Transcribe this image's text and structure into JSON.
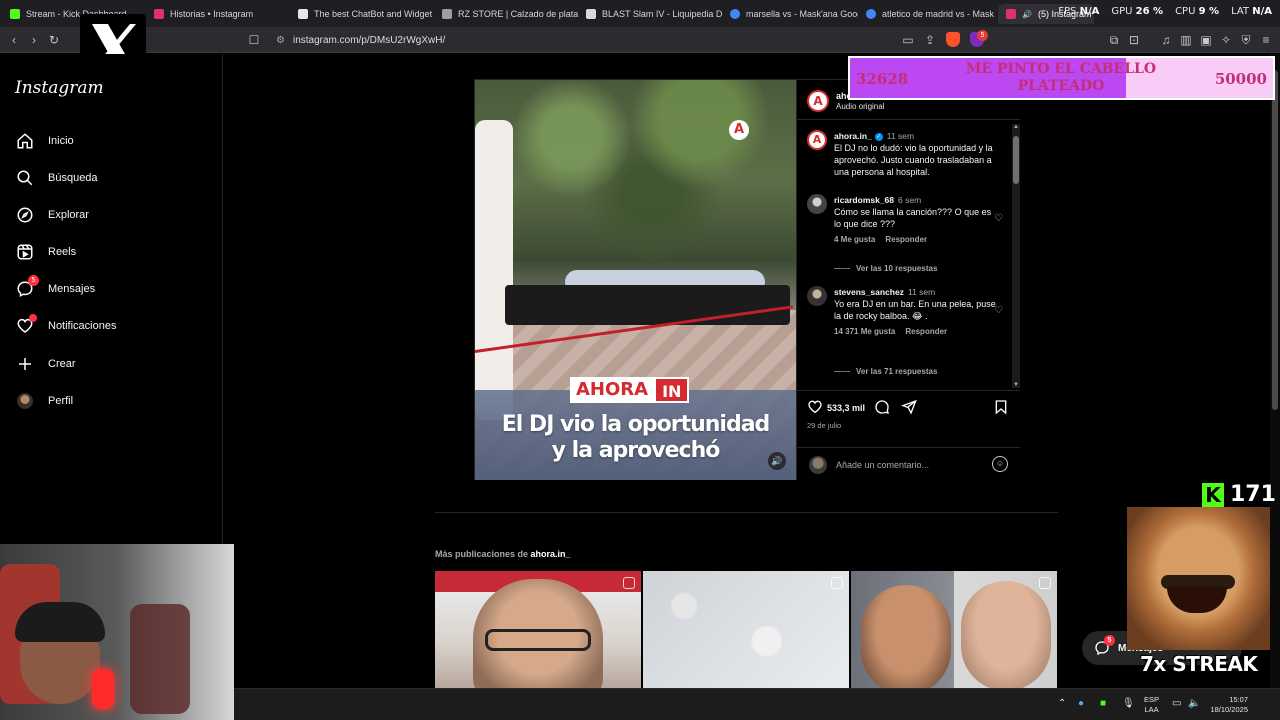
{
  "browser": {
    "tabs": [
      {
        "title": "Stream - Kick Dashboard",
        "fav_color": "#53fc18"
      },
      {
        "title": "Historias • Instagram",
        "fav_color": "#e1306c"
      },
      {
        "title": "The best ChatBot and Widget",
        "fav_color": "#e6e6e6"
      },
      {
        "title": "RZ STORE | Calzado de platafo",
        "fav_color": "#9e9e9e"
      },
      {
        "title": "BLAST Slam IV - Liquipedia Do",
        "fav_color": "#d9d9d9"
      },
      {
        "title": "marsella vs - Mask'ana Google",
        "fav_color": "#4285f4"
      },
      {
        "title": "atletico de madrid vs - Mask'a",
        "fav_color": "#4285f4"
      },
      {
        "title": "(5) Instagram",
        "fav_color": "#e1306c",
        "active": true
      }
    ],
    "url": "instagram.com/p/DMsU2rWgXwH/",
    "perf": {
      "fps_label": "FPS",
      "fps_value": "N/A",
      "gpu_label": "GPU",
      "gpu_value": "26 %",
      "cpu_label": "CPU",
      "cpu_value": "9 %",
      "lat_label": "LAT",
      "lat_value": "N/A"
    },
    "extension_badge": "5"
  },
  "sidebar": {
    "logo": "Instagram",
    "items": [
      {
        "label": "Inicio",
        "icon": "home-icon"
      },
      {
        "label": "Búsqueda",
        "icon": "search-icon"
      },
      {
        "label": "Explorar",
        "icon": "compass-icon"
      },
      {
        "label": "Reels",
        "icon": "reels-icon"
      },
      {
        "label": "Mensajes",
        "icon": "messenger-icon",
        "badge": "5"
      },
      {
        "label": "Notificaciones",
        "icon": "heart-icon",
        "dot": true
      },
      {
        "label": "Crear",
        "icon": "plus-icon"
      },
      {
        "label": "Perfil",
        "icon": "avatar-icon"
      }
    ]
  },
  "post": {
    "author": "ahora.in_",
    "audio": "Audio original",
    "media": {
      "brand_word": "AHORA",
      "brand_tag": "IN",
      "headline_line1": "El DJ vio la oportunidad",
      "headline_line2": "y la aprovechó",
      "logo_letter": "A"
    },
    "comments": [
      {
        "user": "ahora.in_",
        "verified": true,
        "time": "11 sem",
        "text": "El DJ no lo dudó: vio la oportunidad y la aprovechó. Justo cuando trasladaban a una persona al hospital."
      },
      {
        "user": "ricardomsk_68",
        "time": "6 sem",
        "text": "Cómo se llama la canción??? O que es lo que dice ???",
        "likes": "4 Me gusta",
        "reply": "Responder",
        "replies": "Ver las 10 respuestas"
      },
      {
        "user": "stevens_sanchez",
        "time": "11 sem",
        "text": "Yo era DJ en un bar. En una pelea, puse la de rocky balboa. 😂 .",
        "likes": "14 371 Me gusta",
        "reply": "Responder",
        "replies": "Ver las 71 respuestas"
      }
    ],
    "like_count": "533,3 mil",
    "date": "29 de julio",
    "comment_placeholder": "Añade un comentario..."
  },
  "more_posts": {
    "prefix": "Más publicaciones de ",
    "author": "ahora.in_"
  },
  "overlays": {
    "goal": {
      "current": "32628",
      "text": "ME PINTO EL CABELLO PLATEADO",
      "target": "50000",
      "progress": 0.6526
    },
    "kick_count": "171",
    "streak": "7x STREAK",
    "messages_pill": "Mensajes",
    "messages_badge": "5"
  },
  "taskbar": {
    "lang_line1": "ESP",
    "lang_line2": "LAA",
    "time": "15:07",
    "date": "18/10/2025"
  }
}
